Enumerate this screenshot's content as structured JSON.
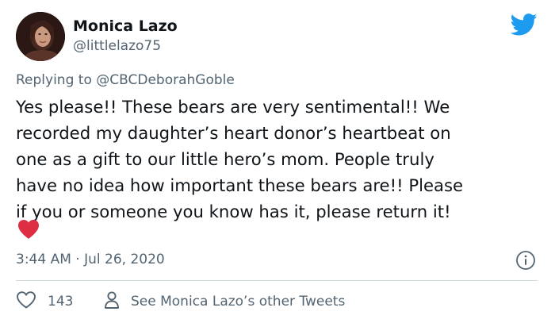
{
  "author": {
    "name": "Monica Lazo",
    "handle": "@littlelazo75"
  },
  "reply": {
    "prefix": "Replying to",
    "target": "@CBCDeborahGoble"
  },
  "tweet": {
    "lines": [
      "Yes please!! These bears are very sentimental!! We",
      "recorded my daughter’s heart donor’s heartbeat on",
      "one as a gift to our little hero’s mom. People truly",
      "have no idea how important these bears are!! Please",
      "if you or someone you know has it, please return it!"
    ],
    "emoji": "red-heart"
  },
  "timestamp": "3:44 AM · Jul 26, 2020",
  "actions": {
    "like_count": "143",
    "other_tweets_label": "See Monica Lazo’s other Tweets"
  },
  "colors": {
    "brand": "#1d9bf0",
    "secondary_text": "#536471",
    "heart": "#e0245e",
    "divider": "#cfd9de"
  },
  "icons": [
    "twitter-bird-icon",
    "info-icon",
    "heart-outline-icon",
    "person-icon",
    "red-heart-emoji"
  ]
}
